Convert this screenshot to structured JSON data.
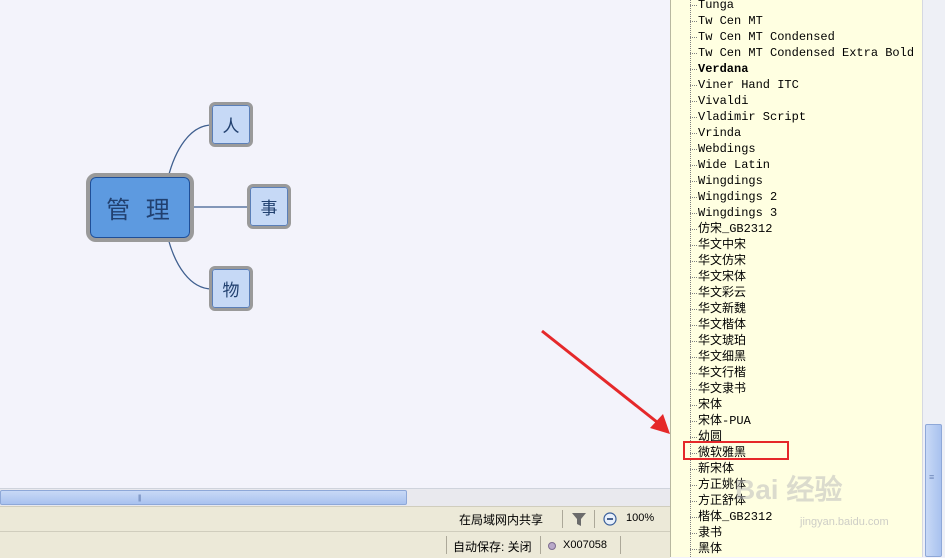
{
  "mindmap": {
    "central": "管 理",
    "branches": [
      "人",
      "事",
      "物"
    ]
  },
  "status": {
    "share_label": "在局域网内共享",
    "zoom": "100%",
    "autosave_label": "自动保存: 关闭",
    "user_id": "X007058"
  },
  "font_list": [
    "Tunga",
    "Tw Cen MT",
    "Tw Cen MT Condensed",
    "Tw Cen MT Condensed Extra Bold",
    "Verdana",
    "Viner Hand ITC",
    "Vivaldi",
    "Vladimir Script",
    "Vrinda",
    "Webdings",
    "Wide Latin",
    "Wingdings",
    "Wingdings 2",
    "Wingdings 3",
    "仿宋_GB2312",
    "华文中宋",
    "华文仿宋",
    "华文宋体",
    "华文彩云",
    "华文新魏",
    "华文楷体",
    "华文琥珀",
    "华文细黑",
    "华文行楷",
    "华文隶书",
    "宋体",
    "宋体-PUA",
    "幼圆",
    "微软雅黑",
    "新宋体",
    "方正姚体",
    "方正舒体",
    "楷体_GB2312",
    "隶书",
    "黑体"
  ],
  "bold_font": "Verdana",
  "highlighted_font": "微软雅黑",
  "watermark": {
    "main": "Bai 经验",
    "sub": "jingyan.baidu.com"
  },
  "colors": {
    "canvas_bg": "#f3f3fb",
    "panel_bg": "#ffffe1",
    "node_main": "#5d9ae0",
    "node_sub": "#c6d9f6",
    "annotation": "#e5282a"
  },
  "icons": [
    "filter-icon",
    "zoom-out-icon",
    "status-dot-icon",
    "grip-icon"
  ]
}
